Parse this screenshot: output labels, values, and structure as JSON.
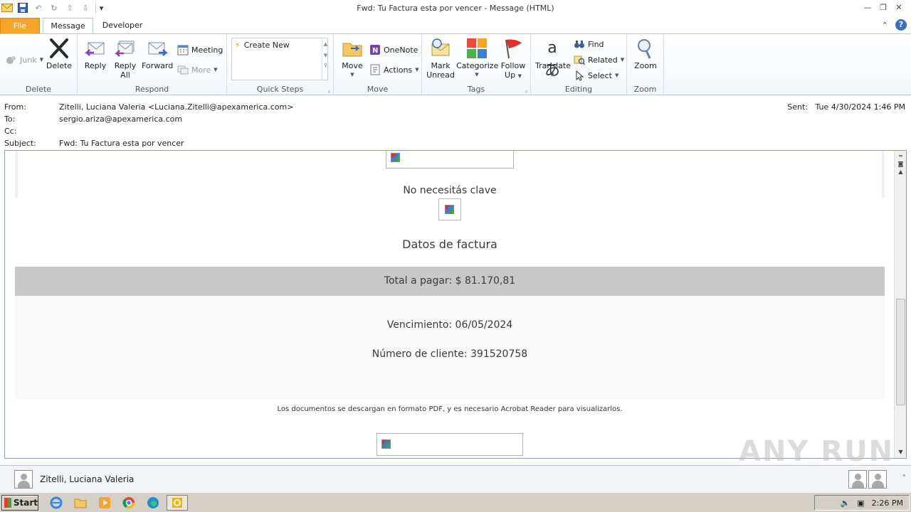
{
  "window": {
    "title": "Fwd: Tu Factura esta por vencer  -  Message (HTML)"
  },
  "tabs": [
    {
      "label": "File"
    },
    {
      "label": "Message"
    },
    {
      "label": "Developer"
    }
  ],
  "ribbon": {
    "delete_group": {
      "label": "Delete",
      "junk": "Junk",
      "delete": "Delete"
    },
    "respond_group": {
      "label": "Respond",
      "reply": "Reply",
      "reply_all_1": "Reply",
      "reply_all_2": "All",
      "forward": "Forward",
      "meeting": "Meeting",
      "more": "More"
    },
    "quicksteps_group": {
      "label": "Quick Steps",
      "create_new": "Create New"
    },
    "move_group": {
      "label": "Move",
      "move": "Move",
      "onenote": "OneNote",
      "actions": "Actions"
    },
    "tags_group": {
      "label": "Tags",
      "mark_unread_1": "Mark",
      "mark_unread_2": "Unread",
      "categorize": "Categorize",
      "follow_up_1": "Follow",
      "follow_up_2": "Up"
    },
    "editing_group": {
      "label": "Editing",
      "translate": "Translate",
      "find": "Find",
      "related": "Related",
      "select": "Select"
    },
    "zoom_group": {
      "label": "Zoom",
      "zoom": "Zoom"
    }
  },
  "header": {
    "from_label": "From:",
    "from_value": "Zitelli, Luciana Valeria <Luciana.Zitelli@apexamerica.com>",
    "to_label": "To:",
    "to_value": "sergio.ariza@apexamerica.com",
    "cc_label": "Cc:",
    "subject_label": "Subject:",
    "subject_value": "Fwd: Tu Factura esta por vencer",
    "sent_label": "Sent:",
    "sent_value": "Tue 4/30/2024 1:46 PM"
  },
  "body": {
    "no_clave": "No necesitás clave",
    "datos_title": "Datos de factura",
    "total": "Total a pagar:  $ 81.170,81",
    "vencimiento": "Vencimiento: 06/05/2024",
    "numero_cliente": "Número de cliente: 391520758",
    "footer_note": "Los documentos se descargan en formato PDF, y es necesario Acrobat Reader para visualizarlos."
  },
  "people_pane": {
    "name": "Zitelli, Luciana Valeria"
  },
  "taskbar": {
    "start": "Start",
    "clock": "2:26 PM"
  },
  "watermark": "ANY RUN",
  "colors": {
    "file_tab": "#f6a52a",
    "total_bar": "#c8c8c8",
    "help_icon": "#3a6fc4"
  }
}
